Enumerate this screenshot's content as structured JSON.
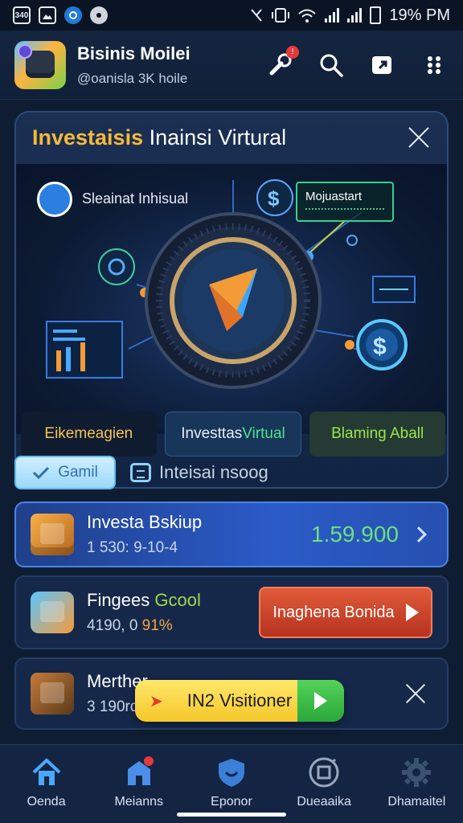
{
  "status_bar": {
    "left_box": "340",
    "time": "19% PM"
  },
  "header": {
    "app_name": "Bisinis Moilei",
    "handle": "@oanisla 3K hoile"
  },
  "feature_card": {
    "title_highlight": "Investaisis",
    "title_rest": " Inainsi Virtural",
    "hero_label": "Sleainat Inhisual",
    "hero_tag": "Mojuastart",
    "tabs": [
      {
        "label": "Eikemeagien"
      },
      {
        "label_a": "Investtas ",
        "label_b": "Virtual"
      },
      {
        "label": "Blaming Aball"
      }
    ]
  },
  "segment": {
    "chip_label": "Gamil",
    "link_label": "Inteisai nsoog"
  },
  "list": {
    "item1": {
      "title": "Investa Bskiup",
      "sub": "1 530: 9-10-4",
      "value": "1.59.900"
    },
    "item2": {
      "title_a": "Fingees ",
      "title_b": "Gcool",
      "sub_a": "4190, 0 ",
      "sub_b": "91%",
      "button": "Inaghena Bonida"
    },
    "item3": {
      "title": "Merther",
      "sub": "3 190rd."
    }
  },
  "toast": {
    "arrow": "➤",
    "label": "IN2 Visitioner"
  },
  "bottom_nav": {
    "items": [
      {
        "label": "Oenda",
        "icon": "home-icon"
      },
      {
        "label": "Meianns",
        "icon": "building-icon"
      },
      {
        "label": "Eponor",
        "icon": "shield-icon"
      },
      {
        "label": "Dueaaika",
        "icon": "compass-icon"
      },
      {
        "label": "Dhamaitel",
        "icon": "gear-icon"
      }
    ]
  },
  "colors": {
    "background": "#0f1d33",
    "accent_gold": "#f6b93b",
    "accent_green": "#6ee07f",
    "action_red": "#c9412a",
    "toast_yellow": "#f5c72a"
  }
}
